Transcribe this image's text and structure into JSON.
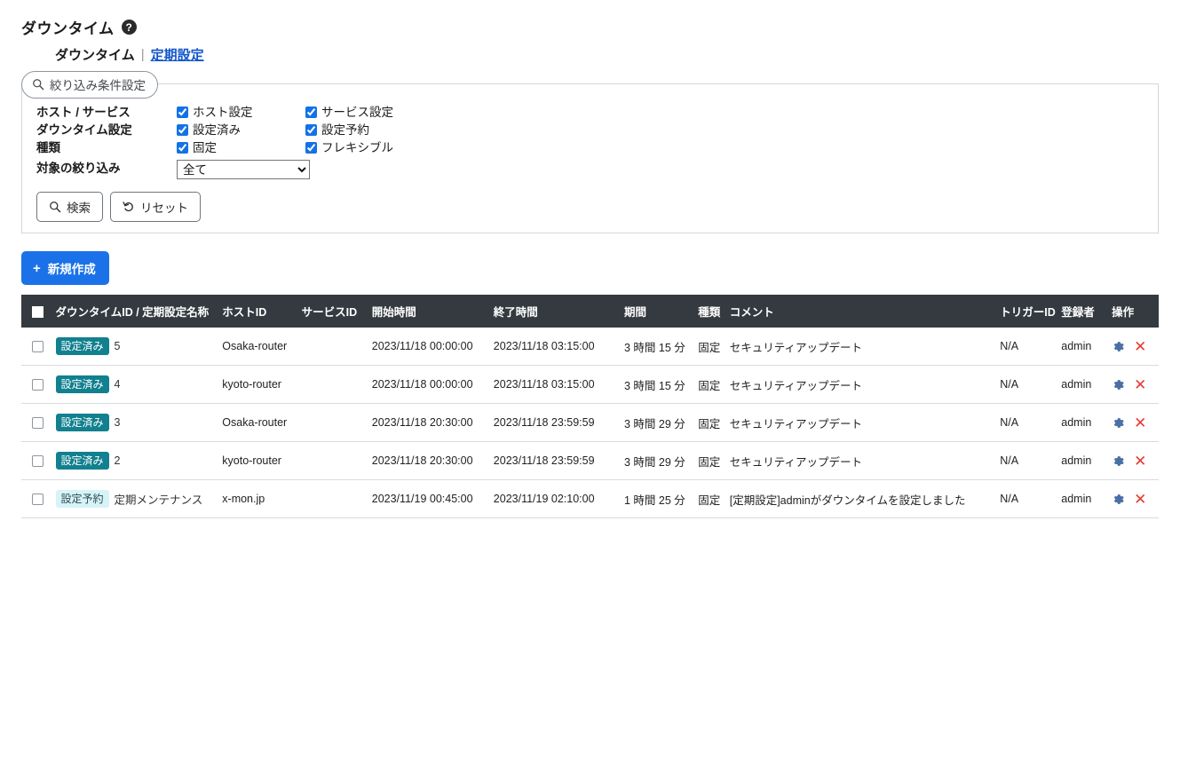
{
  "header": {
    "title": "ダウンタイム",
    "help_icon": "question-mark-icon",
    "subnav": {
      "current": "ダウンタイム",
      "separator": "|",
      "link": "定期設定"
    }
  },
  "filter": {
    "tab_label": "絞り込み条件設定",
    "tab_icon": "search-icon",
    "rows": [
      {
        "label": "ホスト / サービス",
        "left": {
          "label": "ホスト設定",
          "checked": true
        },
        "right": {
          "label": "サービス設定",
          "checked": true
        }
      },
      {
        "label": "ダウンタイム設定",
        "left": {
          "label": "設定済み",
          "checked": true
        },
        "right": {
          "label": "設定予約",
          "checked": true
        }
      },
      {
        "label": "種類",
        "left": {
          "label": "固定",
          "checked": true
        },
        "right": {
          "label": "フレキシブル",
          "checked": true
        }
      }
    ],
    "target": {
      "label": "対象の絞り込み",
      "value": "全て",
      "options": [
        "全て"
      ]
    },
    "search_button": {
      "label": "検索",
      "icon": "search-icon"
    },
    "reset_button": {
      "label": "リセット",
      "icon": "undo-arrow-icon"
    }
  },
  "toolbar": {
    "new_button": {
      "label": "新規作成",
      "icon": "plus-icon"
    }
  },
  "table": {
    "columns": [
      "",
      "ダウンタイムID / 定期設定名称",
      "ホストID",
      "サービスID",
      "開始時間",
      "終了時間",
      "期間",
      "種類",
      "コメント",
      "トリガーID",
      "登録者",
      "操作"
    ],
    "header_select_all": "select-all-checkbox",
    "rows": [
      {
        "checked": false,
        "badge": "設定済み",
        "badge_type": "set",
        "id": "5",
        "host_id": "Osaka-router",
        "service_id": "",
        "start": "2023/11/18 00:00:00",
        "end": "2023/11/18 03:15:00",
        "duration": "3 時間 15 分",
        "kind": "固定",
        "comment": "セキュリティアップデート",
        "trigger_id": "N/A",
        "user": "admin",
        "ops": {
          "edit": "gear-icon",
          "delete": "close-x-icon"
        }
      },
      {
        "checked": false,
        "badge": "設定済み",
        "badge_type": "set",
        "id": "4",
        "host_id": "kyoto-router",
        "service_id": "",
        "start": "2023/11/18 00:00:00",
        "end": "2023/11/18 03:15:00",
        "duration": "3 時間 15 分",
        "kind": "固定",
        "comment": "セキュリティアップデート",
        "trigger_id": "N/A",
        "user": "admin",
        "ops": {
          "edit": "gear-icon",
          "delete": "close-x-icon"
        }
      },
      {
        "checked": false,
        "badge": "設定済み",
        "badge_type": "set",
        "id": "3",
        "host_id": "Osaka-router",
        "service_id": "",
        "start": "2023/11/18 20:30:00",
        "end": "2023/11/18 23:59:59",
        "duration": "3 時間 29 分",
        "kind": "固定",
        "comment": "セキュリティアップデート",
        "trigger_id": "N/A",
        "user": "admin",
        "ops": {
          "edit": "gear-icon",
          "delete": "close-x-icon"
        }
      },
      {
        "checked": false,
        "badge": "設定済み",
        "badge_type": "set",
        "id": "2",
        "host_id": "kyoto-router",
        "service_id": "",
        "start": "2023/11/18 20:30:00",
        "end": "2023/11/18 23:59:59",
        "duration": "3 時間 29 分",
        "kind": "固定",
        "comment": "セキュリティアップデート",
        "trigger_id": "N/A",
        "user": "admin",
        "ops": {
          "edit": "gear-icon",
          "delete": "close-x-icon"
        }
      },
      {
        "checked": false,
        "badge": "設定予約",
        "badge_type": "reserved",
        "id": "定期メンテナンス",
        "host_id": "x-mon.jp",
        "service_id": "",
        "start": "2023/11/19 00:45:00",
        "end": "2023/11/19 02:10:00",
        "duration": "1 時間 25 分",
        "kind": "固定",
        "comment": "[定期設定]adminがダウンタイムを設定しました",
        "trigger_id": "N/A",
        "user": "admin",
        "ops": {
          "edit": "gear-icon",
          "delete": "close-x-icon"
        }
      }
    ]
  },
  "colors": {
    "primary": "#1b72e8",
    "header_bar": "#343a40",
    "badge_set_bg": "#11808f",
    "badge_reserved_bg": "#d6f3f7",
    "delete_icon": "#e33b33",
    "gear_icon": "#4a6fa5",
    "link": "#1155cc"
  }
}
